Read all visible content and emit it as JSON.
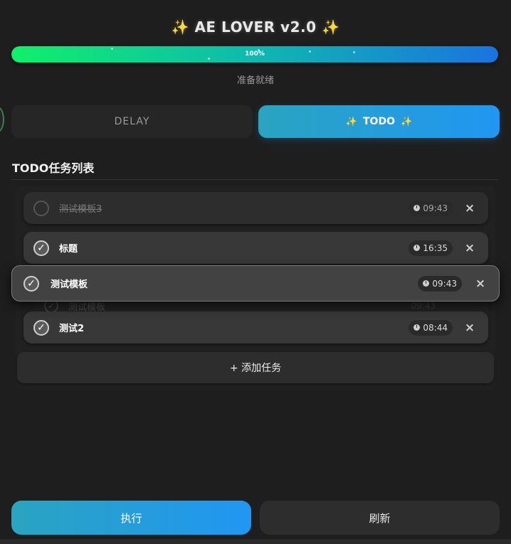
{
  "header": {
    "title": "AE LOVER v2.0",
    "sparkle_left": "✨",
    "sparkle_right": "✨"
  },
  "progress": {
    "value": 1.0,
    "label": "100%",
    "status": "准备就绪"
  },
  "tabs": {
    "delay_label": "DELAY",
    "todo_label": "TODO",
    "active": "todo"
  },
  "todo": {
    "section_title": "TODO任务列表",
    "tasks": [
      {
        "name": "测试模板3",
        "time": "09:43",
        "done": false
      },
      {
        "name": "标题",
        "time": "16:35",
        "done": true
      },
      {
        "name": "测试模板",
        "time": "09:43",
        "done": true
      },
      {
        "name": "测试2",
        "time": "08:44",
        "done": true
      }
    ],
    "delete_symbol": "×",
    "add_label": "+ 添加任务"
  },
  "actions": {
    "run_label": "执行",
    "refresh_label": "刷新"
  },
  "colors": {
    "accent_start": "#2aa4c0",
    "accent_end": "#2196f3",
    "progress_start": "#0ff06a",
    "progress_end": "#1a73e0",
    "background": "#1e1e1e"
  }
}
